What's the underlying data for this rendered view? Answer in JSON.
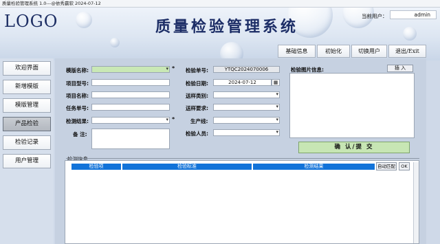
{
  "window": {
    "title": "质量检验管理系统 1.0---@依秀赢软 2024-07-12"
  },
  "header": {
    "logo": "LOGO",
    "app_title": "质量检验管理系统",
    "user_label": "当前用户：",
    "user_value": "admin"
  },
  "toolbar": {
    "buttons": [
      "基础信息",
      "初始化",
      "切换用户",
      "退出/Exit"
    ]
  },
  "nav": {
    "items": [
      "欢迎界面",
      "新增模版",
      "模版管理",
      "产品检验",
      "检验记录",
      "用户管理"
    ],
    "active_index": 3
  },
  "form": {
    "template_name_label": "模版名称:",
    "project_model_label": "项目型号:",
    "project_name_label": "项目名称:",
    "task_no_label": "任务单号:",
    "result_label": "检测结果:",
    "remark_label": "备  注:",
    "inspect_no_label": "检验单号:",
    "inspect_no_value": "YTQC2024070006",
    "inspect_date_label": "检验日期:",
    "inspect_date_value": "2024-07-12",
    "sample_type_label": "送样类别:",
    "sample_req_label": "送样要求:",
    "line_label": "生产线:",
    "inspector_label": "检验人员:",
    "required_mark": "*",
    "image_label": "检验图片信息:",
    "insert_button": "插 入",
    "submit_button": "确 认/提 交"
  },
  "detection": {
    "section_label": "检测信息",
    "columns": [
      "检验项",
      "检验标准",
      "检测结果"
    ],
    "auto_match_button": "自动匹配",
    "ok_button": "OK"
  }
}
